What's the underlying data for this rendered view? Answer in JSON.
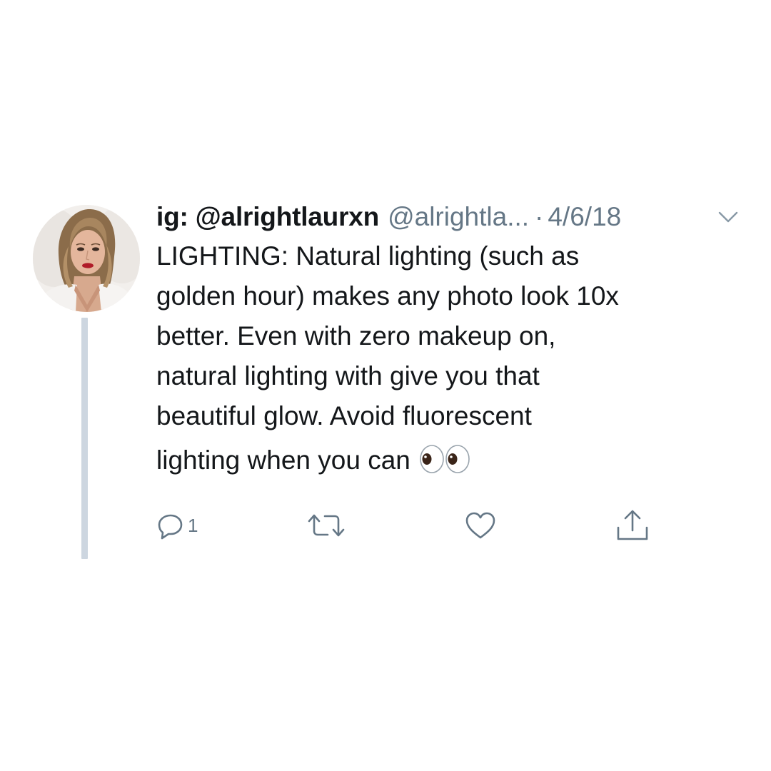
{
  "tweet": {
    "display_name": "ig: @alrightlaurxn",
    "handle": "@alrightla...",
    "separator": "·",
    "date": "4/6/18",
    "text_lines": [
      "LIGHTING: Natural lighting (such as",
      "golden hour) makes any photo look 10x",
      "better. Even with zero makeup on,",
      "natural lighting with give you that",
      "beautiful glow. Avoid fluorescent",
      "lighting when you can"
    ],
    "emoji": "eyes"
  },
  "actions": {
    "reply": {
      "icon": "reply-icon",
      "count": "1"
    },
    "retweet": {
      "icon": "retweet-icon"
    },
    "like": {
      "icon": "heart-icon"
    },
    "share": {
      "icon": "share-icon"
    }
  },
  "colors": {
    "text": "#14171a",
    "secondary": "#657786",
    "thread_line": "#cdd6e0"
  }
}
